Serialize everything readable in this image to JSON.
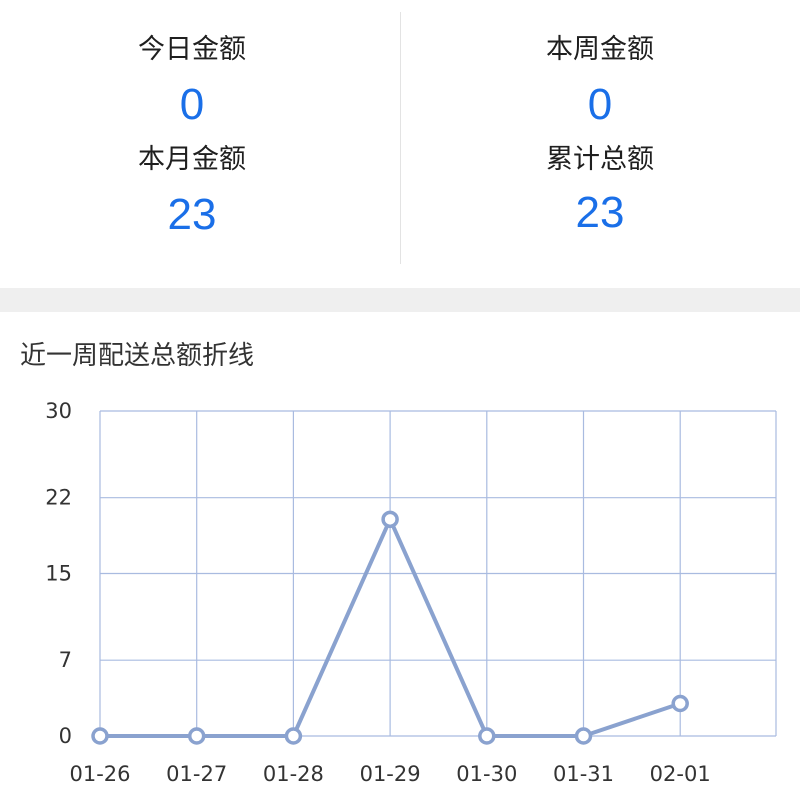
{
  "stats": {
    "today_label": "今日金额",
    "today_value": "0",
    "week_label": "本周金额",
    "week_value": "0",
    "month_label": "本月金额",
    "month_value": "23",
    "total_label": "累计总额",
    "total_value": "23"
  },
  "chart_title": "近一周配送总额折线",
  "colors": {
    "accent": "#1a6fe8",
    "line": "#8aa2cf",
    "grid": "#a9bbe0",
    "band": "#efefef"
  },
  "chart_data": {
    "type": "line",
    "categories": [
      "01-26",
      "01-27",
      "01-28",
      "01-29",
      "01-30",
      "01-31",
      "02-01"
    ],
    "values": [
      0,
      0,
      0,
      20,
      0,
      0,
      3
    ],
    "y_ticks": [
      "0",
      "7",
      "15",
      "22",
      "30"
    ],
    "ylim": [
      0,
      30
    ],
    "grid": true,
    "legend": "none"
  }
}
